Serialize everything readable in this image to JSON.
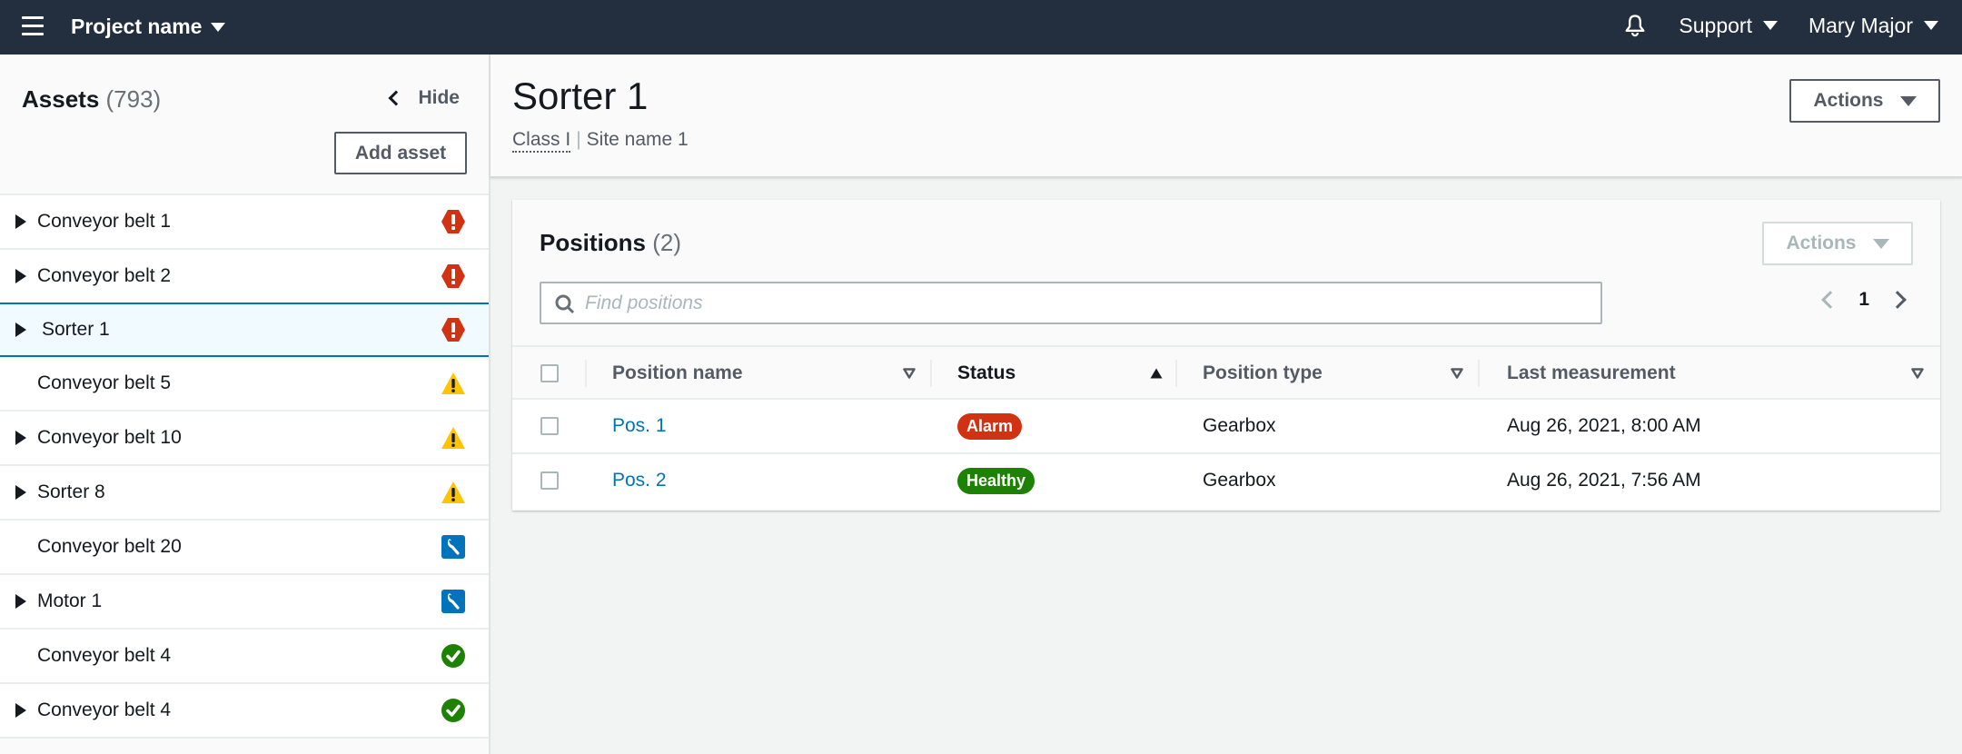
{
  "topnav": {
    "project_name": "Project name",
    "support_label": "Support",
    "user_name": "Mary Major"
  },
  "sidebar": {
    "title": "Assets",
    "count": "(793)",
    "hide_label": "Hide",
    "add_asset_label": "Add asset",
    "items": [
      {
        "name": "Conveyor belt 1",
        "expandable": true,
        "status": "alarm"
      },
      {
        "name": "Conveyor belt 2",
        "expandable": true,
        "status": "alarm"
      },
      {
        "name": "Sorter 1",
        "expandable": true,
        "status": "alarm",
        "selected": true
      },
      {
        "name": "Conveyor belt 5",
        "expandable": false,
        "status": "warning"
      },
      {
        "name": "Conveyor belt 10",
        "expandable": true,
        "status": "warning"
      },
      {
        "name": "Sorter 8",
        "expandable": true,
        "status": "warning"
      },
      {
        "name": "Conveyor belt 20",
        "expandable": false,
        "status": "maintenance"
      },
      {
        "name": "Motor 1",
        "expandable": true,
        "status": "maintenance"
      },
      {
        "name": "Conveyor belt 4",
        "expandable": false,
        "status": "healthy"
      },
      {
        "name": "Conveyor belt 4",
        "expandable": true,
        "status": "healthy"
      }
    ]
  },
  "main": {
    "title": "Sorter 1",
    "class_label": "Class I",
    "separator": "|",
    "site_name": "Site name 1",
    "actions_label": "Actions"
  },
  "positions": {
    "title": "Positions",
    "count": "(2)",
    "actions_label": "Actions",
    "search_placeholder": "Find positions",
    "search_value": "",
    "page": "1",
    "columns": [
      {
        "label": "Position name",
        "sort": "unsorted"
      },
      {
        "label": "Status",
        "sort": "ascending"
      },
      {
        "label": "Position type",
        "sort": "unsorted"
      },
      {
        "label": "Last measurement",
        "sort": "unsorted"
      }
    ],
    "rows": [
      {
        "name": "Pos. 1",
        "status": "Alarm",
        "type": "Gearbox",
        "last_measurement": "Aug 26, 2021, 8:00 AM"
      },
      {
        "name": "Pos. 2",
        "status": "Healthy",
        "type": "Gearbox",
        "last_measurement": "Aug 26, 2021, 7:56 AM"
      }
    ]
  },
  "colors": {
    "nav_bg": "#232f3e",
    "link": "#0073bb",
    "alarm": "#d13212",
    "warning": "#ffc400",
    "maintenance": "#0073bb",
    "healthy": "#1d8102",
    "selected_bg": "#f1faff"
  },
  "icons": {
    "alarm": "alarm-octagon-icon",
    "warning": "warning-triangle-icon",
    "maintenance": "wrench-icon",
    "healthy": "check-circle-icon"
  }
}
